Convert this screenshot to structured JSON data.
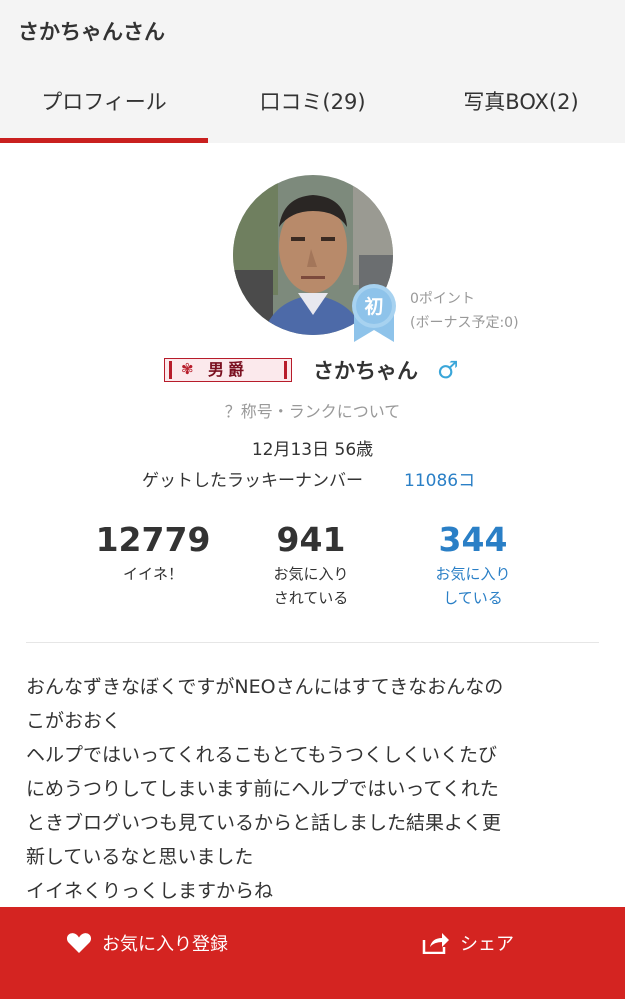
{
  "header": {
    "title": "さかちゃんさん"
  },
  "tabs": [
    {
      "label": "プロフィール",
      "active": true
    },
    {
      "label": "口コミ(29)"
    },
    {
      "label": "写真BOX(2)"
    }
  ],
  "profile": {
    "rank_badge": "初",
    "points": "0ポイント",
    "bonus": "(ボーナス予定:0)",
    "title_badge": "男爵",
    "username": "さかちゃん",
    "gender_symbol": "♂",
    "rank_link": "？称号・ランクについて",
    "birthday": "12月13日 56歳",
    "lucky_label": "ゲットしたラッキーナンバー",
    "lucky_value": "11086コ"
  },
  "stats": [
    {
      "value": "12779",
      "line1": "イイネ！",
      "line2": ""
    },
    {
      "value": "941",
      "line1": "お気に入り",
      "line2": "されている"
    },
    {
      "value": "344",
      "line1": "お気に入り",
      "line2": "している"
    }
  ],
  "bio": [
    "おんなずきなぼくですがNEOさんにはすてきなおんなの",
    "こがおおく",
    "ヘルプではいってくれるこもとてもうつくしくいくたび",
    "にめうつりしてしまいます前にヘルプではいってくれた",
    "ときブログいつも見ているからと話しました結果よく更",
    "新しているなと思いました",
    "イイネくりっくしますからね"
  ],
  "actions": {
    "favorite": "お気に入り登録",
    "share": "シェア"
  },
  "colors": {
    "accent_red": "#d42421",
    "link_blue": "#2a7fc6",
    "gender_blue": "#3aa6d9",
    "badge_blue": "#8ec3ea"
  }
}
